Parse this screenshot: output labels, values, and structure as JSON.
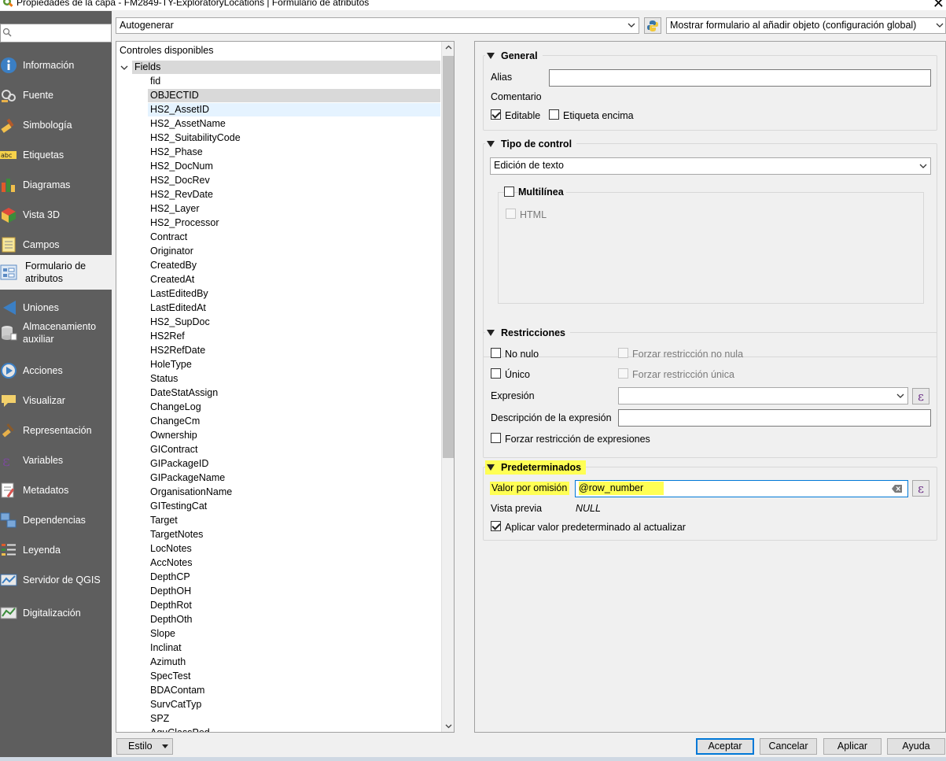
{
  "window": {
    "title": "Propiedades de la capa - FM2849-TY-ExploratoryLocations | Formulario de atributos"
  },
  "sidebar": {
    "search_placeholder": "",
    "items": [
      {
        "label": "Información",
        "icon": "info-icon"
      },
      {
        "label": "Fuente",
        "icon": "source-icon"
      },
      {
        "label": "Simbología",
        "icon": "symbology-icon"
      },
      {
        "label": "Etiquetas",
        "icon": "labels-icon"
      },
      {
        "label": "Diagramas",
        "icon": "diagrams-icon"
      },
      {
        "label": "Vista 3D",
        "icon": "3d-view-icon"
      },
      {
        "label": "Campos",
        "icon": "fields-icon"
      },
      {
        "label": "Formulario de atributos",
        "icon": "attributes-form-icon",
        "active": true
      },
      {
        "label": "Uniones",
        "icon": "joins-icon"
      },
      {
        "label": "Almacenamiento auxiliar",
        "icon": "auxiliary-storage-icon"
      },
      {
        "label": "Acciones",
        "icon": "actions-icon"
      },
      {
        "label": "Visualizar",
        "icon": "display-icon"
      },
      {
        "label": "Representación",
        "icon": "rendering-icon"
      },
      {
        "label": "Variables",
        "icon": "variables-icon"
      },
      {
        "label": "Metadatos",
        "icon": "metadata-icon"
      },
      {
        "label": "Dependencias",
        "icon": "dependencies-icon"
      },
      {
        "label": "Leyenda",
        "icon": "legend-icon"
      },
      {
        "label": "Servidor de QGIS",
        "icon": "qgis-server-icon"
      },
      {
        "label": "Digitalización",
        "icon": "digitizing-icon"
      }
    ]
  },
  "toolbar": {
    "layout_combo": "Autogenerar",
    "form_combo": "Mostrar formulario al añadir objeto (configuración global)"
  },
  "tree": {
    "header": "Controles disponibles",
    "root": "Fields",
    "items": [
      "fid",
      "OBJECTID",
      "HS2_AssetID",
      "HS2_AssetName",
      "HS2_SuitabilityCode",
      "HS2_Phase",
      "HS2_DocNum",
      "HS2_DocRev",
      "HS2_RevDate",
      "HS2_Layer",
      "HS2_Processor",
      "Contract",
      "Originator",
      "CreatedBy",
      "CreatedAt",
      "LastEditedBy",
      "LastEditedAt",
      "HS2_SupDoc",
      "HS2Ref",
      "HS2RefDate",
      "HoleType",
      "Status",
      "DateStatAssign",
      "ChangeLog",
      "ChangeCm",
      "Ownership",
      "GIContract",
      "GIPackageID",
      "GIPackageName",
      "OrganisationName",
      "GITestingCat",
      "Target",
      "TargetNotes",
      "LocNotes",
      "AccNotes",
      "DepthCP",
      "DepthOH",
      "DepthRot",
      "DepthOth",
      "Slope",
      "Inclinat",
      "Azimuth",
      "SpecTest",
      "BDAContam",
      "SurvCatTyp",
      "SPZ",
      "AquClassPed"
    ],
    "selected": "OBJECTID",
    "hovered": "HS2_AssetID"
  },
  "general": {
    "title": "General",
    "alias_label": "Alias",
    "alias_value": "",
    "comment_label": "Comentario",
    "editable_label": "Editable",
    "editable_checked": true,
    "label_on_top_label": "Etiqueta encima",
    "label_on_top_checked": false
  },
  "widget_type": {
    "title": "Tipo de control",
    "value": "Edición de texto",
    "multiline_label": "Multilínea",
    "multiline_checked": false,
    "html_label": "HTML",
    "html_checked": false
  },
  "constraints": {
    "title": "Restricciones",
    "not_null_label": "No nulo",
    "enforce_not_null_label": "Forzar restricción no nula",
    "unique_label": "Único",
    "enforce_unique_label": "Forzar restricción única",
    "expression_label": "Expresión",
    "expression_value": "",
    "expression_desc_label": "Descripción de la expresión",
    "expression_desc_value": "",
    "enforce_expression_label": "Forzar restricción de expresiones"
  },
  "defaults": {
    "title": "Predeterminados",
    "default_value_label": "Valor por omisión",
    "default_value": "@row_number",
    "preview_label": "Vista previa",
    "preview_value": "NULL",
    "apply_on_update_label": "Aplicar valor predeterminado al actualizar",
    "apply_on_update_checked": true
  },
  "buttons": {
    "style": "Estilo",
    "ok": "Aceptar",
    "cancel": "Cancelar",
    "apply": "Aplicar",
    "help": "Ayuda"
  },
  "colors": {
    "sidebar_bg": "#5e5e5e",
    "highlight": "#ffff54",
    "selection": "#d9d9d9",
    "hover": "#e5f3ff",
    "primary_border": "#0078d7"
  }
}
